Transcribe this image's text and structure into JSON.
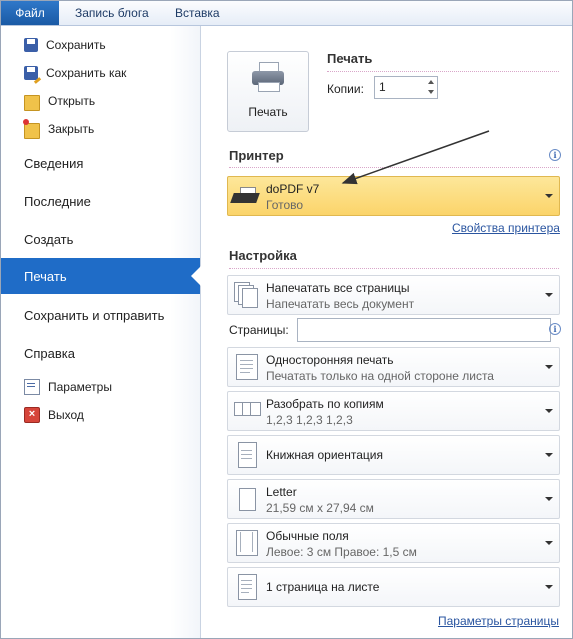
{
  "tabs": {
    "file": "Файл",
    "blog": "Запись блога",
    "insert": "Вставка"
  },
  "sidebar": {
    "items": [
      {
        "label": "Сохранить",
        "icon": "save-icon"
      },
      {
        "label": "Сохранить как",
        "icon": "save-as-icon"
      },
      {
        "label": "Открыть",
        "icon": "open-folder-icon"
      },
      {
        "label": "Закрыть",
        "icon": "close-folder-icon"
      },
      {
        "label": "Сведения"
      },
      {
        "label": "Последние"
      },
      {
        "label": "Создать"
      },
      {
        "label": "Печать",
        "active": true
      },
      {
        "label": "Сохранить и отправить"
      },
      {
        "label": "Справка"
      },
      {
        "label": "Параметры",
        "icon": "options-icon"
      },
      {
        "label": "Выход",
        "icon": "exit-icon"
      }
    ]
  },
  "print": {
    "section_title": "Печать",
    "button_label": "Печать",
    "copies_label": "Копии:",
    "copies_value": "1"
  },
  "printer": {
    "section_title": "Принтер",
    "name": "doPDF v7",
    "status": "Готово",
    "properties_link": "Свойства принтера"
  },
  "settings": {
    "section_title": "Настройка",
    "pages_label": "Страницы:",
    "pages_value": "",
    "items": [
      {
        "title": "Напечатать все страницы",
        "subtitle": "Напечатать весь документ"
      },
      {
        "title": "Односторонняя печать",
        "subtitle": "Печатать только на одной стороне листа"
      },
      {
        "title": "Разобрать по копиям",
        "subtitle": "1,2,3    1,2,3    1,2,3"
      },
      {
        "title": "Книжная ориентация",
        "subtitle": ""
      },
      {
        "title": "Letter",
        "subtitle": "21,59 см x 27,94 см"
      },
      {
        "title": "Обычные поля",
        "subtitle": "Левое: 3 см    Правое: 1,5 см"
      },
      {
        "title": "1 страница на листе",
        "subtitle": ""
      }
    ],
    "page_setup_link": "Параметры страницы"
  },
  "colors": {
    "accent": "#1f6cc7",
    "printer_highlight": "#fbd46a",
    "link": "#2a55a0"
  }
}
